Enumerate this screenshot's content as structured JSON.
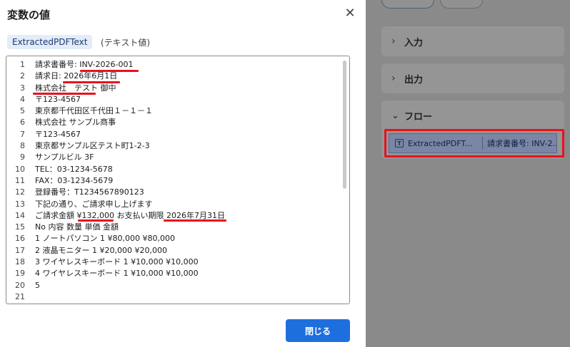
{
  "dialog": {
    "title": "変数の値",
    "close_glyph": "✕",
    "variable_name": "ExtractedPDFText",
    "variable_type": "(テキスト値)",
    "close_button_label": "閉じる",
    "lines": [
      {
        "num": "1",
        "text": "請求書番号: INV-2026-001"
      },
      {
        "num": "2",
        "text": "請求日: 2026年6月1日"
      },
      {
        "num": "3",
        "text": "株式会社　テスト 御中"
      },
      {
        "num": "4",
        "text": "〒123-4567"
      },
      {
        "num": "5",
        "text": "東京都千代田区千代田１－１－１"
      },
      {
        "num": "6",
        "text": "株式会社 サンプル商事"
      },
      {
        "num": "7",
        "text": "〒123-4567"
      },
      {
        "num": "8",
        "text": "東京都サンプル区テスト町1-2-3"
      },
      {
        "num": "9",
        "text": "サンプルビル 3F"
      },
      {
        "num": "10",
        "text": "TEL：03-1234-5678"
      },
      {
        "num": "11",
        "text": "FAX：03-1234-5679"
      },
      {
        "num": "12",
        "text": "登録番号：T1234567890123"
      },
      {
        "num": "13",
        "text": "下記の通り、ご請求申し上げます"
      },
      {
        "num": "14",
        "text": "ご請求金額 ¥132,000 お支払い期限 2026年7月31日"
      },
      {
        "num": "15",
        "text": "No 内容 数量 単価 金額"
      },
      {
        "num": "16",
        "text": "1 ノートパソコン 1 ¥80,000 ¥80,000"
      },
      {
        "num": "17",
        "text": "2 液晶モニター 1 ¥20,000 ¥20,000"
      },
      {
        "num": "18",
        "text": "3 ワイヤレスキーボード 1 ¥10,000 ¥10,000"
      },
      {
        "num": "19",
        "text": "4 ワイヤレスキーボード 1 ¥10,000 ¥10,000"
      },
      {
        "num": "20",
        "text": "5"
      },
      {
        "num": "21",
        "text": ""
      }
    ]
  },
  "background": {
    "sections": [
      {
        "label": "入力",
        "chevron": "›"
      },
      {
        "label": "出力",
        "chevron": "›"
      }
    ],
    "flow": {
      "label": "フロー",
      "chevron": "⌄",
      "item_icon": "T",
      "item_name": "ExtractedPDFT...",
      "item_value": "請求書番号: INV-2..."
    }
  },
  "icons": {
    "close": "close-icon",
    "chevron": "chevron-right-icon",
    "text_variable": "text-variable-icon"
  },
  "colors": {
    "primary_button": "#1e6fde",
    "annotation_red": "#e8121e",
    "chip_bg": "#e4ecf8",
    "overlay": "#8a8a8a"
  }
}
